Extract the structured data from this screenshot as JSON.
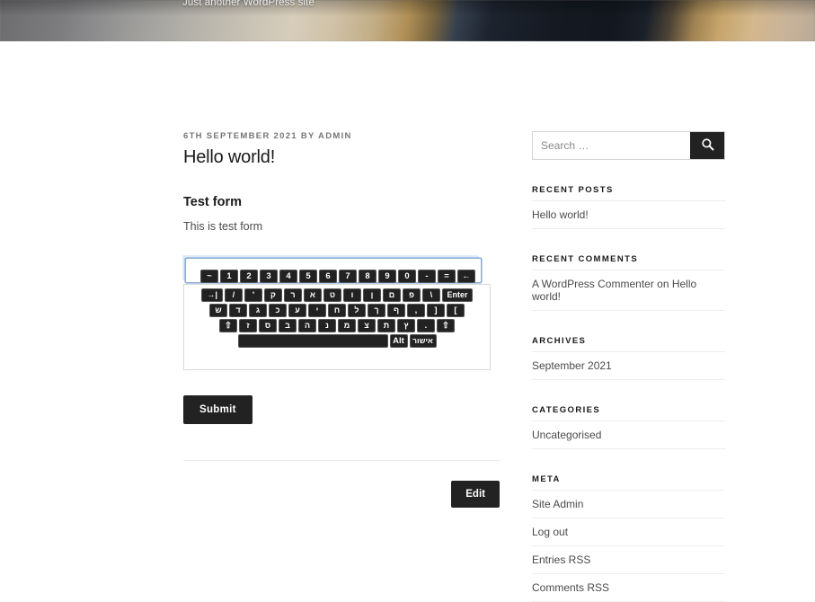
{
  "site": {
    "tagline": "Just another WordPress site"
  },
  "post": {
    "meta": "6TH SEPTEMBER 2021 BY ADMIN",
    "title": "Hello world!",
    "form_heading": "Test form",
    "form_description": "This is test form",
    "input_value": "",
    "input_placeholder": "",
    "submit_label": "Submit",
    "edit_label": "Edit"
  },
  "keyboard": {
    "rows": [
      {
        "name": "number-row",
        "keys": [
          {
            "label": "~",
            "name": "tilde",
            "class": ""
          },
          {
            "label": "1",
            "name": "1",
            "class": ""
          },
          {
            "label": "2",
            "name": "2",
            "class": ""
          },
          {
            "label": "3",
            "name": "3",
            "class": ""
          },
          {
            "label": "4",
            "name": "4",
            "class": ""
          },
          {
            "label": "5",
            "name": "5",
            "class": ""
          },
          {
            "label": "6",
            "name": "6",
            "class": ""
          },
          {
            "label": "7",
            "name": "7",
            "class": ""
          },
          {
            "label": "8",
            "name": "8",
            "class": ""
          },
          {
            "label": "9",
            "name": "9",
            "class": ""
          },
          {
            "label": "0",
            "name": "0",
            "class": ""
          },
          {
            "label": "-",
            "name": "minus",
            "class": ""
          },
          {
            "label": "=",
            "name": "equals",
            "class": ""
          },
          {
            "label": "←",
            "name": "backspace",
            "class": ""
          }
        ]
      },
      {
        "name": "tab-row",
        "keys": [
          {
            "label": "→|",
            "name": "tab",
            "class": "wide"
          },
          {
            "label": "/",
            "name": "slash",
            "class": ""
          },
          {
            "label": "'",
            "name": "apostrophe",
            "class": ""
          },
          {
            "label": "ק",
            "name": "qof",
            "class": "hebrew"
          },
          {
            "label": "ר",
            "name": "resh",
            "class": "hebrew"
          },
          {
            "label": "א",
            "name": "alef",
            "class": "hebrew"
          },
          {
            "label": "ט",
            "name": "tet",
            "class": "hebrew"
          },
          {
            "label": "ו",
            "name": "vav",
            "class": "hebrew"
          },
          {
            "label": "ן",
            "name": "final-nun",
            "class": "hebrew"
          },
          {
            "label": "ם",
            "name": "final-mem",
            "class": "hebrew"
          },
          {
            "label": "פ",
            "name": "pe",
            "class": "hebrew"
          },
          {
            "label": "\\",
            "name": "backslash",
            "class": ""
          },
          {
            "label": "Enter",
            "name": "enter",
            "class": "enter"
          }
        ]
      },
      {
        "name": "home-row",
        "keys": [
          {
            "label": "ש",
            "name": "shin",
            "class": "hebrew"
          },
          {
            "label": "ד",
            "name": "dalet",
            "class": "hebrew"
          },
          {
            "label": "ג",
            "name": "gimel",
            "class": "hebrew"
          },
          {
            "label": "כ",
            "name": "kaf",
            "class": "hebrew"
          },
          {
            "label": "ע",
            "name": "ayin",
            "class": "hebrew"
          },
          {
            "label": "י",
            "name": "yod",
            "class": "hebrew"
          },
          {
            "label": "ח",
            "name": "het",
            "class": "hebrew"
          },
          {
            "label": "ל",
            "name": "lamed",
            "class": "hebrew"
          },
          {
            "label": "ך",
            "name": "final-kaf",
            "class": "hebrew"
          },
          {
            "label": "ף",
            "name": "final-pe",
            "class": "hebrew"
          },
          {
            "label": ",",
            "name": "comma",
            "class": ""
          },
          {
            "label": "]",
            "name": "bracket-right",
            "class": ""
          },
          {
            "label": "[",
            "name": "bracket-left",
            "class": ""
          }
        ]
      },
      {
        "name": "shift-row",
        "keys": [
          {
            "label": "⇧",
            "name": "shift-left",
            "class": ""
          },
          {
            "label": "ז",
            "name": "zayin",
            "class": "hebrew"
          },
          {
            "label": "ס",
            "name": "samekh",
            "class": "hebrew"
          },
          {
            "label": "ב",
            "name": "bet",
            "class": "hebrew"
          },
          {
            "label": "ה",
            "name": "he",
            "class": "hebrew"
          },
          {
            "label": "נ",
            "name": "nun",
            "class": "hebrew"
          },
          {
            "label": "מ",
            "name": "mem",
            "class": "hebrew"
          },
          {
            "label": "צ",
            "name": "tsadi",
            "class": "hebrew"
          },
          {
            "label": "ת",
            "name": "tav",
            "class": "hebrew"
          },
          {
            "label": "ץ",
            "name": "final-tsadi",
            "class": "hebrew"
          },
          {
            "label": ".",
            "name": "period",
            "class": ""
          },
          {
            "label": "⇧",
            "name": "shift-right",
            "class": ""
          }
        ]
      },
      {
        "name": "space-row",
        "keys": [
          {
            "label": " ",
            "name": "space",
            "class": "space"
          },
          {
            "label": "Alt",
            "name": "alt",
            "class": "alt"
          },
          {
            "label": "אישור",
            "name": "confirm",
            "class": "ok"
          }
        ]
      }
    ]
  },
  "sidebar": {
    "search": {
      "placeholder": "Search …",
      "value": "",
      "button_icon": "search-icon"
    },
    "widgets": [
      {
        "title": "RECENT POSTS",
        "name": "recent-posts",
        "items": [
          "Hello world!"
        ]
      },
      {
        "title": "RECENT COMMENTS",
        "name": "recent-comments",
        "items": [
          "A WordPress Commenter on Hello world!"
        ]
      },
      {
        "title": "ARCHIVES",
        "name": "archives",
        "items": [
          "September 2021"
        ]
      },
      {
        "title": "CATEGORIES",
        "name": "categories",
        "items": [
          "Uncategorised"
        ]
      },
      {
        "title": "META",
        "name": "meta",
        "items": [
          "Site Admin",
          "Log out",
          "Entries RSS",
          "Comments RSS"
        ]
      }
    ]
  },
  "colors": {
    "accent_dark": "#222222",
    "text": "#4a4a4a",
    "heading": "#1a1a1a",
    "muted": "#767676",
    "rule": "#ededed",
    "focus_ring": "#78aae6"
  }
}
